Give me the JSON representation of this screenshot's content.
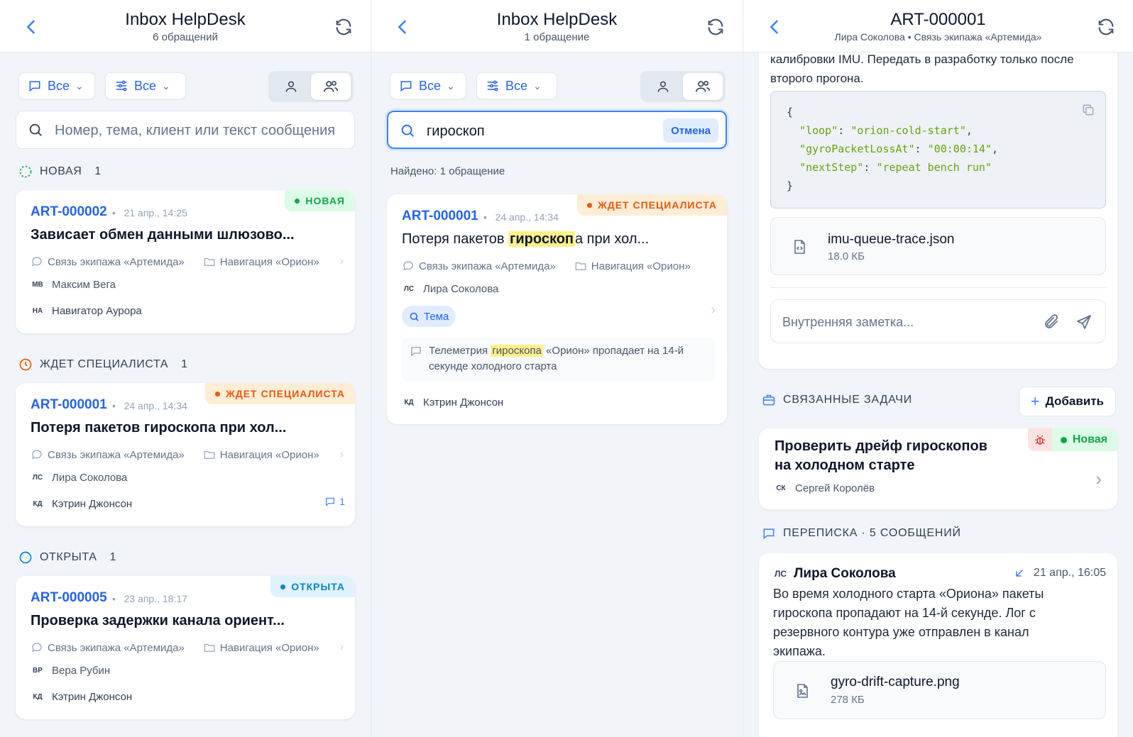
{
  "panels": {
    "list": {
      "header": {
        "title": "Inbox HelpDesk",
        "subtitle": "6 обращений"
      },
      "filters": {
        "channel": "Все",
        "status": "Все"
      },
      "search": {
        "placeholder": "Номер, тема, клиент или текст сообщения"
      },
      "groups": [
        {
          "label": "НОВАЯ",
          "count": "1",
          "card": {
            "id": "ART-000002",
            "date": "21 апр., 14:25",
            "badge": "НОВАЯ",
            "title": "Зависает обмен данными шлюзово...",
            "channel": "Связь экипажа «Артемида»",
            "project": "Навигация «Орион»",
            "client_initials": "МВ",
            "client": "Максим Вега",
            "assignee_initials": "НА",
            "assignee": "Навигатор Аурора",
            "comments": ""
          }
        },
        {
          "label": "ЖДЕТ СПЕЦИАЛИСТА",
          "count": "1",
          "card": {
            "id": "ART-000001",
            "date": "24 апр., 14:34",
            "badge": "ЖДЕТ СПЕЦИАЛИСТА",
            "title": "Потеря пакетов гироскопа при хол...",
            "channel": "Связь экипажа «Артемида»",
            "project": "Навигация «Орион»",
            "client_initials": "ЛС",
            "client": "Лира Соколова",
            "assignee_initials": "КД",
            "assignee": "Кэтрин Джонсон",
            "comments": "1"
          }
        },
        {
          "label": "ОТКРЫТА",
          "count": "1",
          "card": {
            "id": "ART-000005",
            "date": "23 апр., 18:17",
            "badge": "ОТКРЫТА",
            "title": "Проверка задержки канала ориент...",
            "channel": "Связь экипажа «Артемида»",
            "project": "Навигация «Орион»",
            "client_initials": "ВР",
            "client": "Вера Рубин",
            "assignee_initials": "КД",
            "assignee": "Кэтрин Джонсон",
            "comments": ""
          }
        }
      ]
    },
    "search": {
      "header": {
        "title": "Inbox HelpDesk",
        "subtitle": "1 обращение"
      },
      "filters": {
        "channel": "Все",
        "status": "Все"
      },
      "search": {
        "value": "гироскоп",
        "cancel": "Отмена"
      },
      "found": "Найдено: 1 обращение",
      "card": {
        "id": "ART-000001",
        "date": "24 апр., 14:34",
        "badge": "ЖДЕТ СПЕЦИАЛИСТА",
        "title_before": "Потеря пакетов ",
        "title_match": "гироскоп",
        "title_after": "а при хол...",
        "channel": "Связь экипажа «Артемида»",
        "project": "Навигация «Орион»",
        "client_initials": "ЛС",
        "client": "Лира Соколова",
        "match_chip": "Тема",
        "snippet_before": "Телеметрия ",
        "snippet_match": "гироскопа",
        "snippet_after": " «Орион» пропадает на 14-й секунде холодного старта",
        "assignee_initials": "КД",
        "assignee": "Кэтрин Джонсон"
      }
    },
    "detail": {
      "header": {
        "title": "ART-000001",
        "subtitle": "Лира Соколова • Связь экипажа «Артемида»"
      },
      "note_text_line1": "калибровки IMU. Передать в разработку только после",
      "note_text_line2": "второго прогона.",
      "code": {
        "k1": "\"loop\"",
        "v1": "\"orion-cold-start\"",
        "k2": "\"gyroPacketLossAt\"",
        "v2": "\"00:00:14\"",
        "k3": "\"nextStep\"",
        "v3": "\"repeat bench run\""
      },
      "attachment": {
        "name": "imu-queue-trace.json",
        "size": "18.0 КБ"
      },
      "internal_note": {
        "placeholder": "Внутренняя заметка..."
      },
      "tasks": {
        "title": "СВЯЗАННЫЕ ЗАДАЧИ",
        "add": "Добавить",
        "item": {
          "title_line1": "Проверить дрейф гироскопов",
          "title_line2": "на холодном старте",
          "status": "Новая",
          "assignee_initials": "СК",
          "assignee": "Сергей Королёв"
        }
      },
      "thread": {
        "title": "ПЕРЕПИСКА · 5 СООБЩЕНИЙ",
        "message": {
          "author_initials": "ЛС",
          "author": "Лира Соколова",
          "date": "21 апр., 16:05",
          "l1": "Во время холодного старта «Ориона» пакеты",
          "l2": "гироскопа пропадают на 14-й секунде. Лог с",
          "l3": "резервного контура уже отправлен в канал",
          "l4": "экипажа.",
          "file": {
            "name": "gyro-drift-capture.png",
            "size": "278 КБ"
          }
        }
      }
    }
  },
  "colors": {
    "accent": "#2563eb",
    "new": "#16a34a",
    "waiting": "#ea580c",
    "open": "#0284c7"
  }
}
